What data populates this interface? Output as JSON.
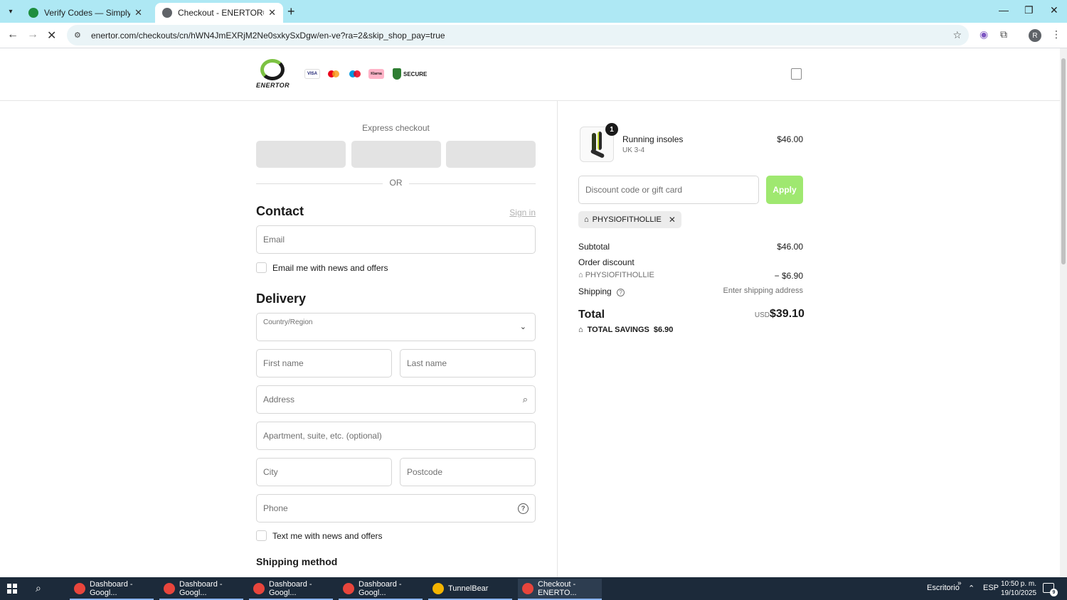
{
  "browser": {
    "tabs": [
      {
        "title": "Verify Codes — SimplyCodes",
        "active": false
      },
      {
        "title": "Checkout - ENERTOR®",
        "active": true
      }
    ],
    "url": "enertor.com/checkouts/cn/hWN4JmEXRjM2Ne0sxkySxDgw/en-ve?ra=2&skip_shop_pay=true",
    "profile_initial": "R"
  },
  "header": {
    "logo_text": "ENERTOR",
    "payment_badges": [
      "VISA",
      "MC",
      "Maestro",
      "Klarna"
    ],
    "secure_text": "SECURE"
  },
  "checkout": {
    "express_label": "Express checkout",
    "or_text": "OR",
    "contact_title": "Contact",
    "sign_in": "Sign in",
    "email_placeholder": "Email",
    "email_news": "Email me with news and offers",
    "delivery_title": "Delivery",
    "country_label": "Country/Region",
    "first_name_placeholder": "First name",
    "last_name_placeholder": "Last name",
    "address_placeholder": "Address",
    "apartment_placeholder": "Apartment, suite, etc. (optional)",
    "city_placeholder": "City",
    "postcode_placeholder": "Postcode",
    "phone_placeholder": "Phone",
    "text_news": "Text me with news and offers",
    "shipping_method_title": "Shipping method"
  },
  "summary": {
    "item": {
      "name": "Running insoles",
      "variant": "UK 3-4",
      "price": "$46.00",
      "quantity": "1"
    },
    "discount_placeholder": "Discount code or gift card",
    "apply_label": "Apply",
    "applied_code": "PHYSIOFITHOLLIE",
    "subtotal_label": "Subtotal",
    "subtotal_value": "$46.00",
    "order_discount_label": "Order discount",
    "discount_code": "PHYSIOFITHOLLIE",
    "discount_value": "− $6.90",
    "shipping_label": "Shipping",
    "shipping_value": "Enter shipping address",
    "total_label": "Total",
    "currency": "USD",
    "total_value": "$39.10",
    "savings_label": "TOTAL SAVINGS",
    "savings_value": "$6.90"
  },
  "taskbar": {
    "items": [
      {
        "label": "Dashboard - Googl...",
        "active": false
      },
      {
        "label": "Dashboard - Googl...",
        "active": false
      },
      {
        "label": "Dashboard - Googl...",
        "active": false
      },
      {
        "label": "Dashboard - Googl...",
        "active": false
      },
      {
        "label": "TunnelBear",
        "active": false
      },
      {
        "label": "Checkout - ENERTO...",
        "active": true
      }
    ],
    "desktop_label": "Escritorio",
    "language": "ESP",
    "time": "10:50 p. m.",
    "date": "19/10/2025",
    "notifications": "9"
  },
  "colors": {
    "tabbar": "#aee8f4",
    "apply_button": "#9fe870",
    "taskbar": "#1c2a3a"
  }
}
